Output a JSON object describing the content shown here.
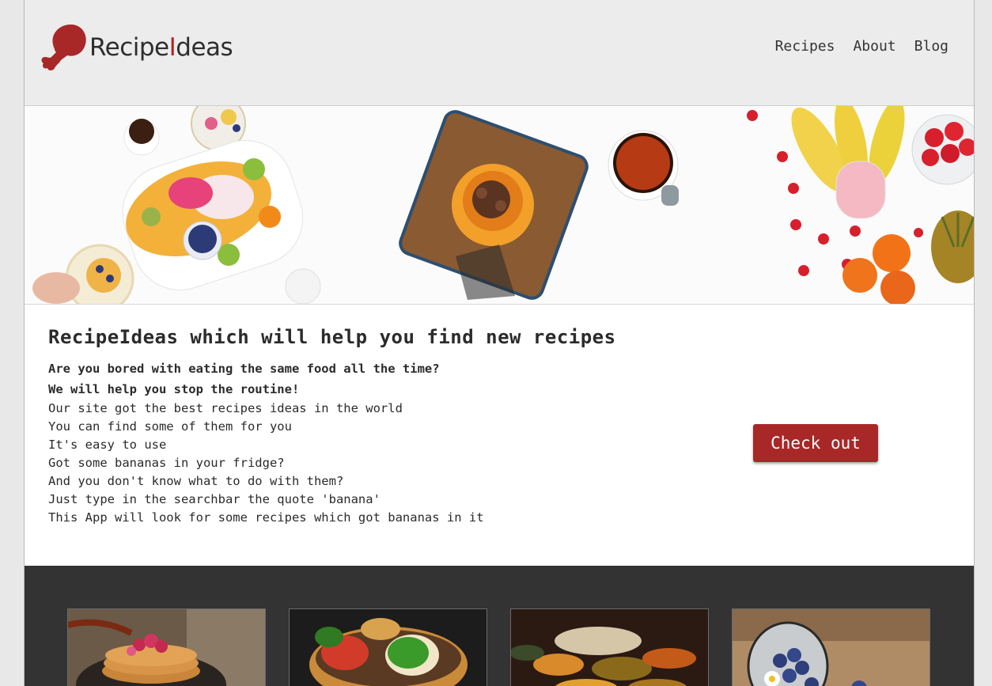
{
  "header": {
    "logo": {
      "part1": "Recipe",
      "part2": "I",
      "part3": "deas",
      "icon": "drumstick-icon"
    },
    "nav": [
      {
        "label": "Recipes"
      },
      {
        "label": "About"
      },
      {
        "label": "Blog"
      }
    ]
  },
  "hero": {
    "image": "breakfast-flatlay-image"
  },
  "intro": {
    "title": "RecipeIdeas which will help you find new recipes",
    "bold_lines": [
      "Are you bored with eating the same food all the time?",
      "We will help you stop the routine!"
    ],
    "lines": [
      "Our site got the best recipes ideas in the world",
      "You can find some of them for you",
      "It's easy to use",
      "Got some bananas in your fridge?",
      "And you don't know what to do with them?",
      "Just type in the searchbar the quote 'banana'",
      "This App will look for some recipes which got bananas in it"
    ],
    "cta_label": "Check out"
  },
  "gallery": {
    "cards": [
      {
        "image": "pancakes-image"
      },
      {
        "image": "burger-image"
      },
      {
        "image": "spices-image"
      },
      {
        "image": "blueberries-image"
      }
    ]
  },
  "colors": {
    "accent": "#a82828",
    "header_bg": "#ececec",
    "footer_bg": "#333333"
  }
}
